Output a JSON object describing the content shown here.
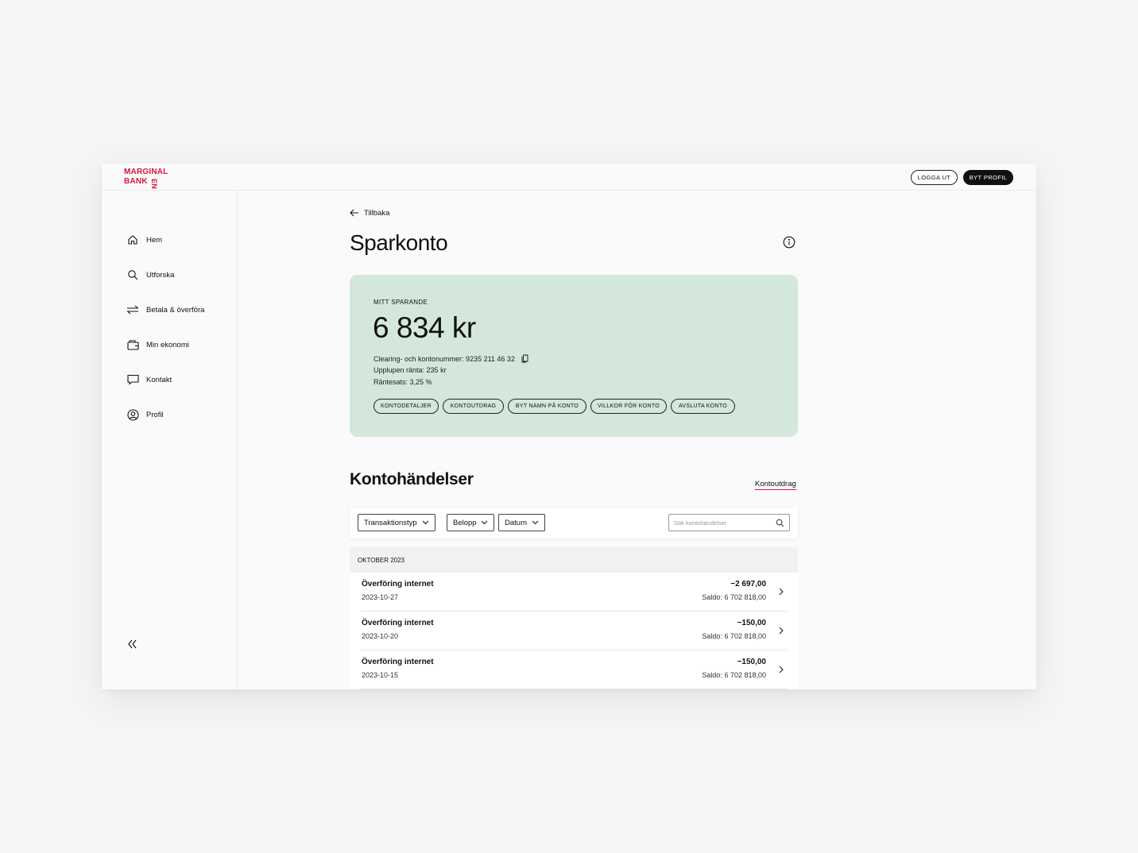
{
  "brand": {
    "line1": "MARGINAL",
    "line2": "BANK",
    "suffix": "EN",
    "color": "#d6163b"
  },
  "topbar": {
    "logout_label": "LOGGA UT",
    "switch_profile_label": "BYT PROFIL"
  },
  "sidebar": {
    "items": [
      {
        "label": "Hem",
        "icon": "home-icon"
      },
      {
        "label": "Utforska",
        "icon": "search-icon"
      },
      {
        "label": "Betala & överföra",
        "icon": "transfer-icon"
      },
      {
        "label": "Min ekonomi",
        "icon": "wallet-icon"
      },
      {
        "label": "Kontakt",
        "icon": "chat-icon"
      },
      {
        "label": "Profil",
        "icon": "user-icon"
      }
    ],
    "collapse_icon": "double-chevron-left-icon"
  },
  "main": {
    "back_label": "Tillbaka",
    "title": "Sparkonto",
    "card": {
      "label": "MITT SPARANDE",
      "amount": "6 834 kr",
      "account_number": "Clearing- och kontonummer: 9235 211 46 32",
      "accrued_interest": "Upplupen ränta: 235 kr",
      "interest_rate": "Räntesats: 3,25 %",
      "actions": [
        "KONTODETALJER",
        "KONTOUTDRAG",
        "BYT NAMN PÅ KONTO",
        "VILLKOR FÖR KONTO",
        "AVSLUTA KONTO"
      ],
      "background": "#d3e8da"
    },
    "events": {
      "title": "Kontohändelser",
      "statement_link": "Kontoutdrag",
      "filters": [
        "Transaktionstyp",
        "Belopp",
        "Datum"
      ],
      "search_placeholder": "Sök kontohändelser",
      "month": "OKTOBER 2023",
      "transactions": [
        {
          "title": "Överföring internet",
          "date": "2023-10-27",
          "amount": "−2 697,00",
          "balance": "Saldo: 6 702 818,00"
        },
        {
          "title": "Överföring internet",
          "date": "2023-10-20",
          "amount": "−150,00",
          "balance": "Saldo: 6 702 818,00"
        },
        {
          "title": "Överföring internet",
          "date": "2023-10-15",
          "amount": "−150,00",
          "balance": "Saldo: 6 702 818,00"
        }
      ]
    }
  }
}
